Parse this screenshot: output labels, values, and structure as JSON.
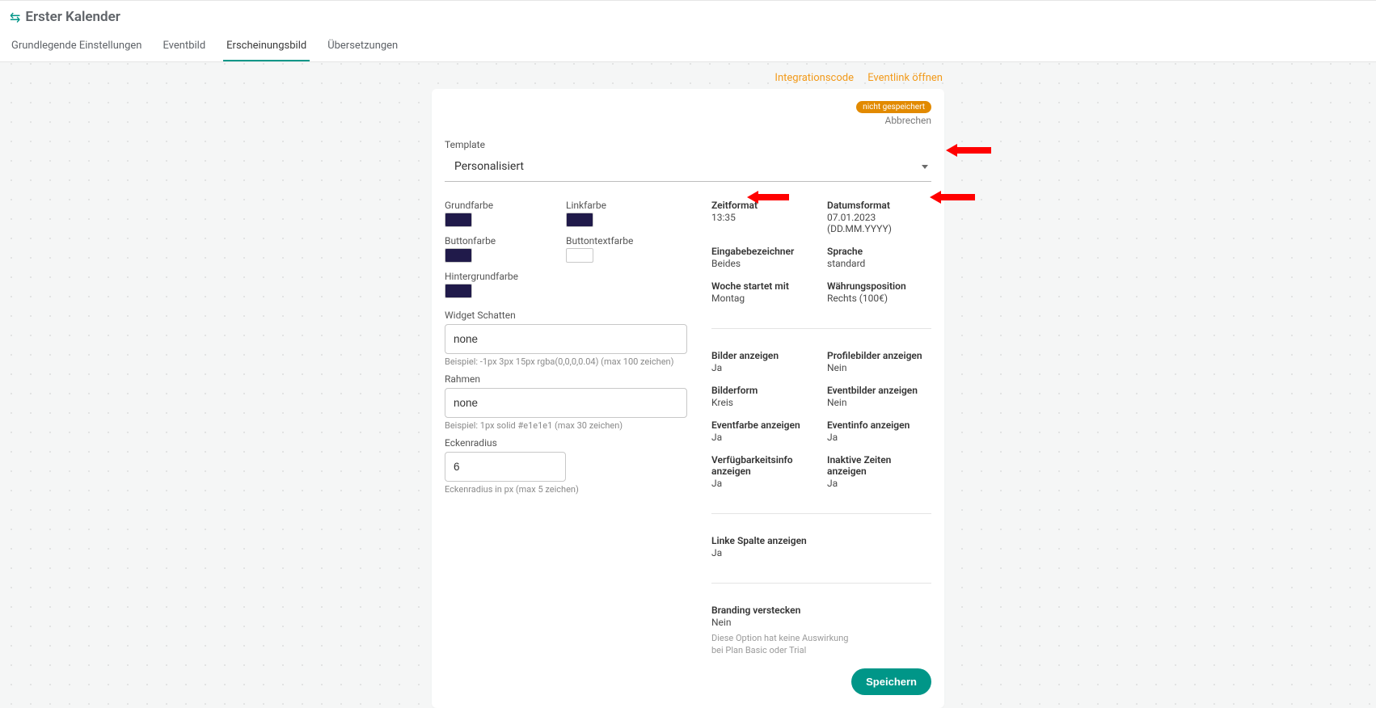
{
  "header": {
    "title": "Erster Kalender",
    "tabs": [
      {
        "label": "Grundlegende Einstellungen",
        "active": false
      },
      {
        "label": "Eventbild",
        "active": false
      },
      {
        "label": "Erscheinungsbild",
        "active": true
      },
      {
        "label": "Übersetzungen",
        "active": false
      }
    ]
  },
  "top_links": {
    "integration_code": "Integrationscode",
    "open_eventlink": "Eventlink öffnen"
  },
  "card": {
    "badge": "nicht gespeichert",
    "cancel": "Abbrechen",
    "template_label": "Template",
    "template_value": "Personalisiert",
    "colors": {
      "grundfarbe": {
        "label": "Grundfarbe",
        "hex": "#201a4a"
      },
      "linkfarbe": {
        "label": "Linkfarbe",
        "hex": "#201a4a"
      },
      "buttonfarbe": {
        "label": "Buttonfarbe",
        "hex": "#201a4a"
      },
      "buttontextfarbe": {
        "label": "Buttontextfarbe",
        "hex": "#ffffff"
      },
      "hintergrundfarbe": {
        "label": "Hintergrundfarbe",
        "hex": "#201a4a"
      }
    },
    "widget_shadow": {
      "label": "Widget Schatten",
      "value": "none",
      "helper": "Beispiel: -1px 3px 15px rgba(0,0,0,0.04) (max 100 zeichen)"
    },
    "border": {
      "label": "Rahmen",
      "value": "none",
      "helper": "Beispiel: 1px solid #e1e1e1 (max 30 zeichen)"
    },
    "corner_radius": {
      "label": "Eckenradius",
      "value": "6",
      "helper": "Eckenradius in px (max 5 zeichen)"
    },
    "props": {
      "zeitformat": {
        "label": "Zeitformat",
        "value": "13:35"
      },
      "datumsformat": {
        "label": "Datumsformat",
        "value": "07.01.2023 (DD.MM.YYYY)"
      },
      "eingabebezeichner": {
        "label": "Eingabebezeichner",
        "value": "Beides"
      },
      "sprache": {
        "label": "Sprache",
        "value": "standard"
      },
      "woche_start": {
        "label": "Woche startet mit",
        "value": "Montag"
      },
      "waehrungsposition": {
        "label": "Währungsposition",
        "value": "Rechts (100€)"
      },
      "bilder_anzeigen": {
        "label": "Bilder anzeigen",
        "value": "Ja"
      },
      "profilebilder_anzeigen": {
        "label": "Profilebilder anzeigen",
        "value": "Nein"
      },
      "bilderform": {
        "label": "Bilderform",
        "value": "Kreis"
      },
      "eventbilder_anzeigen": {
        "label": "Eventbilder anzeigen",
        "value": "Nein"
      },
      "eventfarbe_anzeigen": {
        "label": "Eventfarbe anzeigen",
        "value": "Ja"
      },
      "eventinfo_anzeigen": {
        "label": "Eventinfo anzeigen",
        "value": "Ja"
      },
      "verfuegbarkeitsinfo": {
        "label": "Verfügbarkeitsinfo anzeigen",
        "value": "Ja"
      },
      "inaktive_zeiten": {
        "label": "Inaktive Zeiten anzeigen",
        "value": "Ja"
      },
      "linke_spalte": {
        "label": "Linke Spalte anzeigen",
        "value": "Ja"
      },
      "branding": {
        "label": "Branding verstecken",
        "value": "Nein",
        "note": "Diese Option hat keine Auswirkung bei Plan Basic oder Trial"
      }
    },
    "save_label": "Speichern"
  }
}
